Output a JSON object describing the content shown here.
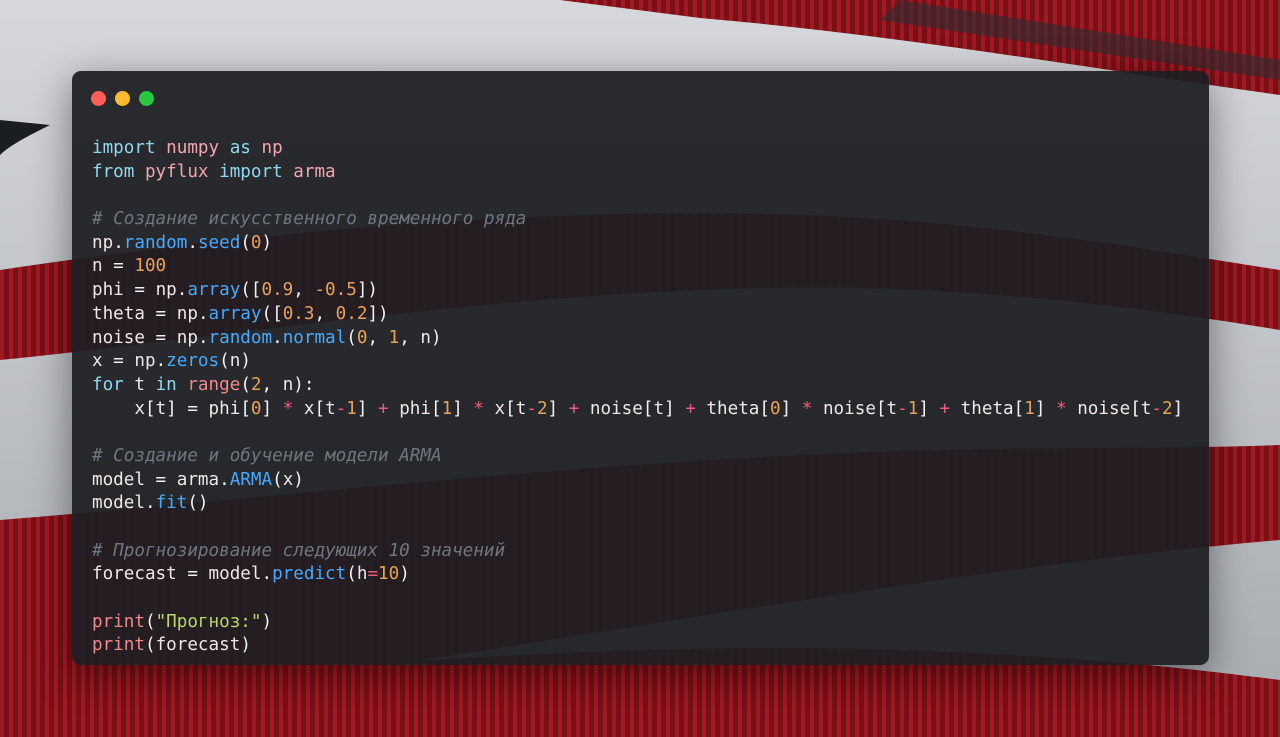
{
  "colors": {
    "accent_keyword": "#8fd8ef",
    "function": "#47a9ff",
    "number": "#e8a25a",
    "operator": "#f05a7a",
    "comment": "#6e7682",
    "string": "#b6d96a",
    "editor_background": "#1e1f22"
  },
  "window_controls": [
    {
      "name": "close",
      "color": "#ff5f57"
    },
    {
      "name": "minimize",
      "color": "#febc2e"
    },
    {
      "name": "maximize",
      "color": "#28c840"
    }
  ],
  "code_lines": [
    [
      {
        "t": "import",
        "c": "kw"
      },
      {
        "t": " numpy ",
        "c": "mod"
      },
      {
        "t": "as",
        "c": "kw"
      },
      {
        "t": " np",
        "c": "mod"
      }
    ],
    [
      {
        "t": "from",
        "c": "kw"
      },
      {
        "t": " pyflux ",
        "c": "mod"
      },
      {
        "t": "import",
        "c": "kw"
      },
      {
        "t": " arma",
        "c": "mod"
      }
    ],
    [],
    [
      {
        "t": "# Создание искусственного временного ряда",
        "c": "cm"
      }
    ],
    [
      {
        "t": "np",
        "c": "var"
      },
      {
        "t": ".",
        "c": "plain"
      },
      {
        "t": "random",
        "c": "fn"
      },
      {
        "t": ".",
        "c": "plain"
      },
      {
        "t": "seed",
        "c": "fn"
      },
      {
        "t": "(",
        "c": "plain"
      },
      {
        "t": "0",
        "c": "num"
      },
      {
        "t": ")",
        "c": "plain"
      }
    ],
    [
      {
        "t": "n",
        "c": "var"
      },
      {
        "t": " = ",
        "c": "plain"
      },
      {
        "t": "100",
        "c": "num"
      }
    ],
    [
      {
        "t": "phi",
        "c": "var"
      },
      {
        "t": " = ",
        "c": "plain"
      },
      {
        "t": "np",
        "c": "var"
      },
      {
        "t": ".",
        "c": "plain"
      },
      {
        "t": "array",
        "c": "fn"
      },
      {
        "t": "([",
        "c": "plain"
      },
      {
        "t": "0.9",
        "c": "num"
      },
      {
        "t": ", ",
        "c": "plain"
      },
      {
        "t": "-0.5",
        "c": "num"
      },
      {
        "t": "])",
        "c": "plain"
      }
    ],
    [
      {
        "t": "theta",
        "c": "var"
      },
      {
        "t": " = ",
        "c": "plain"
      },
      {
        "t": "np",
        "c": "var"
      },
      {
        "t": ".",
        "c": "plain"
      },
      {
        "t": "array",
        "c": "fn"
      },
      {
        "t": "([",
        "c": "plain"
      },
      {
        "t": "0.3",
        "c": "num"
      },
      {
        "t": ", ",
        "c": "plain"
      },
      {
        "t": "0.2",
        "c": "num"
      },
      {
        "t": "])",
        "c": "plain"
      }
    ],
    [
      {
        "t": "noise",
        "c": "var"
      },
      {
        "t": " = ",
        "c": "plain"
      },
      {
        "t": "np",
        "c": "var"
      },
      {
        "t": ".",
        "c": "plain"
      },
      {
        "t": "random",
        "c": "fn"
      },
      {
        "t": ".",
        "c": "plain"
      },
      {
        "t": "normal",
        "c": "fn"
      },
      {
        "t": "(",
        "c": "plain"
      },
      {
        "t": "0",
        "c": "num"
      },
      {
        "t": ", ",
        "c": "plain"
      },
      {
        "t": "1",
        "c": "num"
      },
      {
        "t": ", ",
        "c": "plain"
      },
      {
        "t": "n",
        "c": "var"
      },
      {
        "t": ")",
        "c": "plain"
      }
    ],
    [
      {
        "t": "x",
        "c": "var"
      },
      {
        "t": " = ",
        "c": "plain"
      },
      {
        "t": "np",
        "c": "var"
      },
      {
        "t": ".",
        "c": "plain"
      },
      {
        "t": "zeros",
        "c": "fn"
      },
      {
        "t": "(",
        "c": "plain"
      },
      {
        "t": "n",
        "c": "var"
      },
      {
        "t": ")",
        "c": "plain"
      }
    ],
    [
      {
        "t": "for",
        "c": "kw"
      },
      {
        "t": " t ",
        "c": "var"
      },
      {
        "t": "in",
        "c": "kw"
      },
      {
        "t": " ",
        "c": "plain"
      },
      {
        "t": "range",
        "c": "bi"
      },
      {
        "t": "(",
        "c": "plain"
      },
      {
        "t": "2",
        "c": "num"
      },
      {
        "t": ", ",
        "c": "plain"
      },
      {
        "t": "n",
        "c": "var"
      },
      {
        "t": "):",
        "c": "plain"
      }
    ],
    [
      {
        "t": "    x",
        "c": "var"
      },
      {
        "t": "[",
        "c": "plain"
      },
      {
        "t": "t",
        "c": "var"
      },
      {
        "t": "]",
        "c": "plain"
      },
      {
        "t": " = ",
        "c": "plain"
      },
      {
        "t": "phi",
        "c": "var"
      },
      {
        "t": "[",
        "c": "plain"
      },
      {
        "t": "0",
        "c": "num"
      },
      {
        "t": "] ",
        "c": "plain"
      },
      {
        "t": "*",
        "c": "op"
      },
      {
        "t": " x",
        "c": "var"
      },
      {
        "t": "[",
        "c": "plain"
      },
      {
        "t": "t",
        "c": "var"
      },
      {
        "t": "-",
        "c": "op"
      },
      {
        "t": "1",
        "c": "num"
      },
      {
        "t": "] ",
        "c": "plain"
      },
      {
        "t": "+",
        "c": "op"
      },
      {
        "t": " phi",
        "c": "var"
      },
      {
        "t": "[",
        "c": "plain"
      },
      {
        "t": "1",
        "c": "num"
      },
      {
        "t": "] ",
        "c": "plain"
      },
      {
        "t": "*",
        "c": "op"
      },
      {
        "t": " x",
        "c": "var"
      },
      {
        "t": "[",
        "c": "plain"
      },
      {
        "t": "t",
        "c": "var"
      },
      {
        "t": "-",
        "c": "op"
      },
      {
        "t": "2",
        "c": "num"
      },
      {
        "t": "] ",
        "c": "plain"
      },
      {
        "t": "+",
        "c": "op"
      },
      {
        "t": " noise",
        "c": "var"
      },
      {
        "t": "[",
        "c": "plain"
      },
      {
        "t": "t",
        "c": "var"
      },
      {
        "t": "] ",
        "c": "plain"
      },
      {
        "t": "+",
        "c": "op"
      },
      {
        "t": " theta",
        "c": "var"
      },
      {
        "t": "[",
        "c": "plain"
      },
      {
        "t": "0",
        "c": "num"
      },
      {
        "t": "] ",
        "c": "plain"
      },
      {
        "t": "*",
        "c": "op"
      },
      {
        "t": " noise",
        "c": "var"
      },
      {
        "t": "[",
        "c": "plain"
      },
      {
        "t": "t",
        "c": "var"
      },
      {
        "t": "-",
        "c": "op"
      },
      {
        "t": "1",
        "c": "num"
      },
      {
        "t": "] ",
        "c": "plain"
      },
      {
        "t": "+",
        "c": "op"
      },
      {
        "t": " theta",
        "c": "var"
      },
      {
        "t": "[",
        "c": "plain"
      },
      {
        "t": "1",
        "c": "num"
      },
      {
        "t": "] ",
        "c": "plain"
      },
      {
        "t": "*",
        "c": "op"
      },
      {
        "t": " noise",
        "c": "var"
      },
      {
        "t": "[",
        "c": "plain"
      },
      {
        "t": "t",
        "c": "var"
      },
      {
        "t": "-",
        "c": "op"
      },
      {
        "t": "2",
        "c": "num"
      },
      {
        "t": "]",
        "c": "plain"
      }
    ],
    [],
    [
      {
        "t": "# Создание и обучение модели ARMA",
        "c": "cm"
      }
    ],
    [
      {
        "t": "model",
        "c": "var"
      },
      {
        "t": " = ",
        "c": "plain"
      },
      {
        "t": "arma",
        "c": "var"
      },
      {
        "t": ".",
        "c": "plain"
      },
      {
        "t": "ARMA",
        "c": "fn"
      },
      {
        "t": "(",
        "c": "plain"
      },
      {
        "t": "x",
        "c": "var"
      },
      {
        "t": ")",
        "c": "plain"
      }
    ],
    [
      {
        "t": "model",
        "c": "var"
      },
      {
        "t": ".",
        "c": "plain"
      },
      {
        "t": "fit",
        "c": "fn"
      },
      {
        "t": "()",
        "c": "plain"
      }
    ],
    [],
    [
      {
        "t": "# Прогнозирование следующих 10 значений",
        "c": "cm"
      }
    ],
    [
      {
        "t": "forecast",
        "c": "var"
      },
      {
        "t": " = ",
        "c": "plain"
      },
      {
        "t": "model",
        "c": "var"
      },
      {
        "t": ".",
        "c": "plain"
      },
      {
        "t": "predict",
        "c": "fn"
      },
      {
        "t": "(",
        "c": "plain"
      },
      {
        "t": "h",
        "c": "var"
      },
      {
        "t": "=",
        "c": "op"
      },
      {
        "t": "10",
        "c": "num"
      },
      {
        "t": ")",
        "c": "plain"
      }
    ],
    [],
    [
      {
        "t": "print",
        "c": "bi"
      },
      {
        "t": "(",
        "c": "plain"
      },
      {
        "t": "\"Прогноз:\"",
        "c": "str"
      },
      {
        "t": ")",
        "c": "plain"
      }
    ],
    [
      {
        "t": "print",
        "c": "bi"
      },
      {
        "t": "(",
        "c": "plain"
      },
      {
        "t": "forecast",
        "c": "var"
      },
      {
        "t": ")",
        "c": "plain"
      }
    ]
  ]
}
